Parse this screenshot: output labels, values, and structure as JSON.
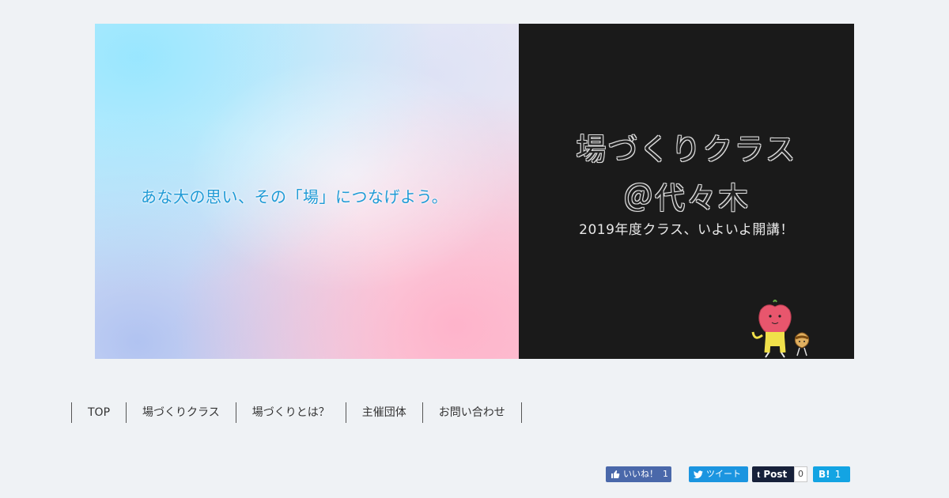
{
  "banner": {
    "catchphrase": "あな大の思い、その「場」につなげよう。",
    "title_line1": "場づくりクラス",
    "title_line2": "＠代々木",
    "subtitle": "2019年度クラス、いよいよ開講！",
    "right_bg": "#1a1a1a",
    "catch_color": "#1f9ad6"
  },
  "nav": {
    "items": [
      {
        "label": "TOP"
      },
      {
        "label": "場づくりクラス"
      },
      {
        "label": "場づくりとは？"
      },
      {
        "label": "主催団体"
      },
      {
        "label": "お問い合わせ"
      }
    ]
  },
  "share": {
    "facebook": {
      "label": "いいね！",
      "count": "1",
      "icon": "thumbs-up-icon",
      "color": "#4a68aa"
    },
    "twitter": {
      "label": "ツイート",
      "icon": "twitter-bird-icon",
      "color": "#1b95e0"
    },
    "tumblr": {
      "label": "Post",
      "count": "0",
      "icon": "tumblr-t-icon",
      "color": "#17213a"
    },
    "hatena": {
      "label": "B!",
      "count": "1",
      "color": "#13a4e3"
    }
  }
}
